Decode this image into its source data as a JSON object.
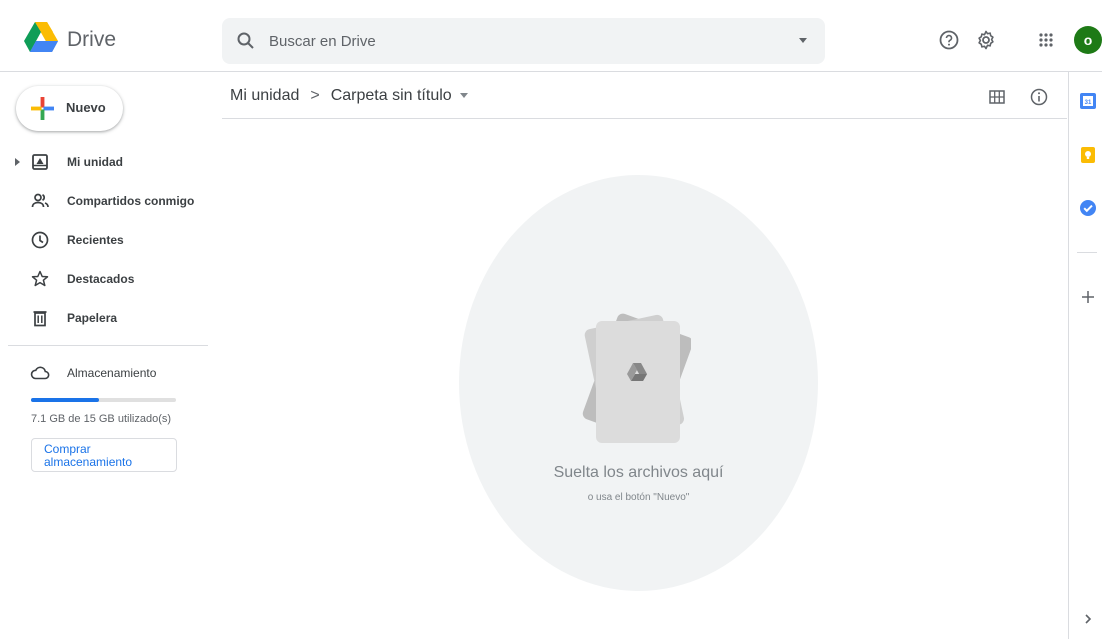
{
  "header": {
    "app_name": "Drive",
    "search_placeholder": "Buscar en Drive",
    "avatar_initial": "o"
  },
  "sidebar": {
    "new_button": "Nuevo",
    "items": [
      {
        "label": "Mi unidad",
        "icon": "my-drive-icon"
      },
      {
        "label": "Compartidos conmigo",
        "icon": "shared-people-icon"
      },
      {
        "label": "Recientes",
        "icon": "clock-icon"
      },
      {
        "label": "Destacados",
        "icon": "star-icon"
      },
      {
        "label": "Papelera",
        "icon": "trash-icon"
      }
    ],
    "storage": {
      "label": "Almacenamiento",
      "icon": "cloud-icon",
      "used_text": "7.1 GB de 15 GB utilizado(s)",
      "used_fraction": 0.47,
      "buy_button": "Comprar almacenamiento"
    }
  },
  "main": {
    "breadcrumb": {
      "root": "Mi unidad",
      "separator": ">",
      "current": "Carpeta sin título"
    },
    "empty_state": {
      "title": "Suelta los archivos aquí",
      "subtitle": "o usa el botón \"Nuevo\""
    }
  },
  "colors": {
    "accent": "#1a73e8",
    "avatar": "#1e7a16",
    "drop_area": "#f1f3f4"
  }
}
